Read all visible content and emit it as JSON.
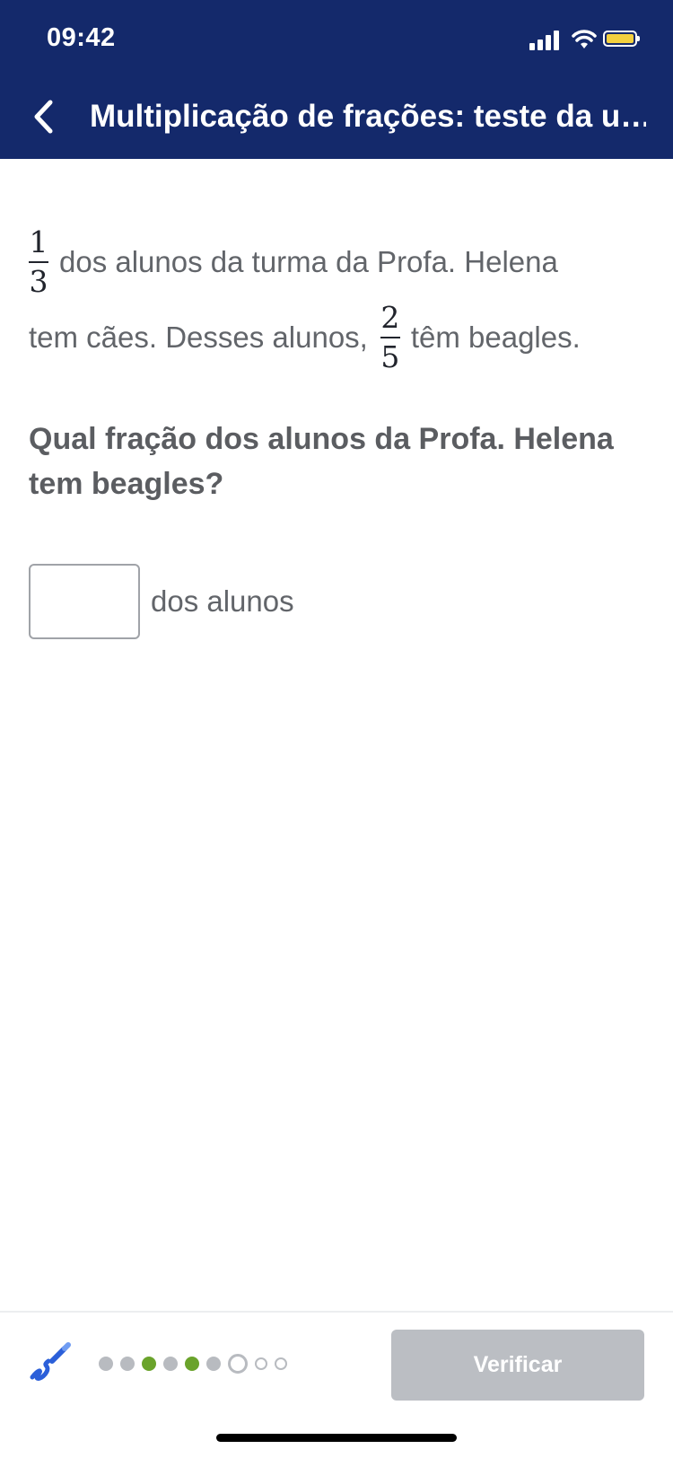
{
  "status_bar": {
    "time": "09:42"
  },
  "header": {
    "title": "Multiplicação de frações: teste da u…",
    "background": "#14296b"
  },
  "problem": {
    "frac1": {
      "numerator": "1",
      "denominator": "3"
    },
    "line1_text": "dos alunos da turma da Profa. Helena",
    "line2_text_before": "tem cães. Desses alunos,",
    "frac2": {
      "numerator": "2",
      "denominator": "5"
    },
    "line2_text_after": "têm beagles."
  },
  "question": "Qual fração dos alunos da Profa. Helena tem beagles?",
  "answer": {
    "value": "",
    "unit_label": "dos alunos"
  },
  "footer": {
    "verify_label": "Verificar",
    "progress_dots": [
      "gray",
      "gray",
      "green",
      "gray",
      "green",
      "gray",
      "current",
      "empty",
      "empty"
    ],
    "icon": "scratchpad-pencil-icon"
  },
  "colors": {
    "accent_green": "#6aa32b",
    "disabled_button": "#bbbec3",
    "text": "#5b5d61"
  }
}
